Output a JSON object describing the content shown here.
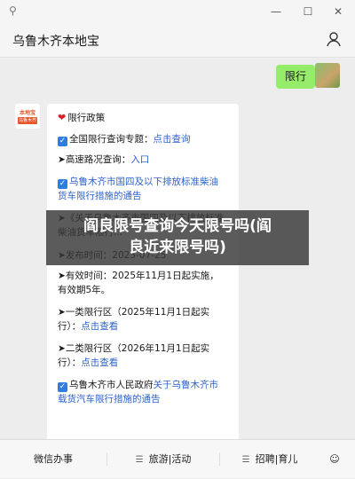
{
  "window": {
    "pin_icon": "pin-icon"
  },
  "header": {
    "title": "乌鲁木齐本地宝"
  },
  "chat": {
    "user_message": "限行",
    "bot_avatar": {
      "line1": "本地宝",
      "line2": "乌鲁木齐"
    },
    "bot_lines": [
      {
        "prefix": "❤",
        "text": "限行政策"
      },
      {
        "prefix": "☑",
        "text": "全国限行查询专题：",
        "link": "点击查询"
      },
      {
        "prefix": "➤",
        "text": "高速路况查询：",
        "link": "入口"
      },
      {
        "prefix": "☑",
        "link": "乌鲁木齐市国四及以下排放标准柴油"
      },
      {
        "link": "货车限行措施的通告"
      },
      {
        "prefix": "➤",
        "text": "《关于乌鲁木齐市国四及以下排放标准"
      },
      {
        "text": "柴油货车限行..."
      },
      {
        "prefix": "➤",
        "text": "发布时间：2025-07-25"
      },
      {
        "prefix": "➤",
        "text": "有效时间：2025年11月1日起实施，"
      },
      {
        "text": "有效期5年。"
      },
      {
        "prefix": "➤",
        "text": "一类限行区（2025年11月1日起实"
      },
      {
        "text": "行）：",
        "link": "点击查看"
      },
      {
        "prefix": "➤",
        "text": "二类限行区（2026年11月1日起实"
      },
      {
        "text": "行）：",
        "link": "点击查看"
      },
      {
        "prefix": "☑",
        "text": "乌鲁木齐市人民政府",
        "link": "关于乌鲁木齐市"
      },
      {
        "link": "载货汽车限行措施的通告"
      }
    ]
  },
  "overlay": {
    "line1": "阎良限号查询今天限号吗(阎",
    "line2": "良近来限号吗)"
  },
  "bottom_menu": [
    {
      "label": "微信办事"
    },
    {
      "label": "旅游|活动"
    },
    {
      "label": "招聘|育儿"
    }
  ]
}
